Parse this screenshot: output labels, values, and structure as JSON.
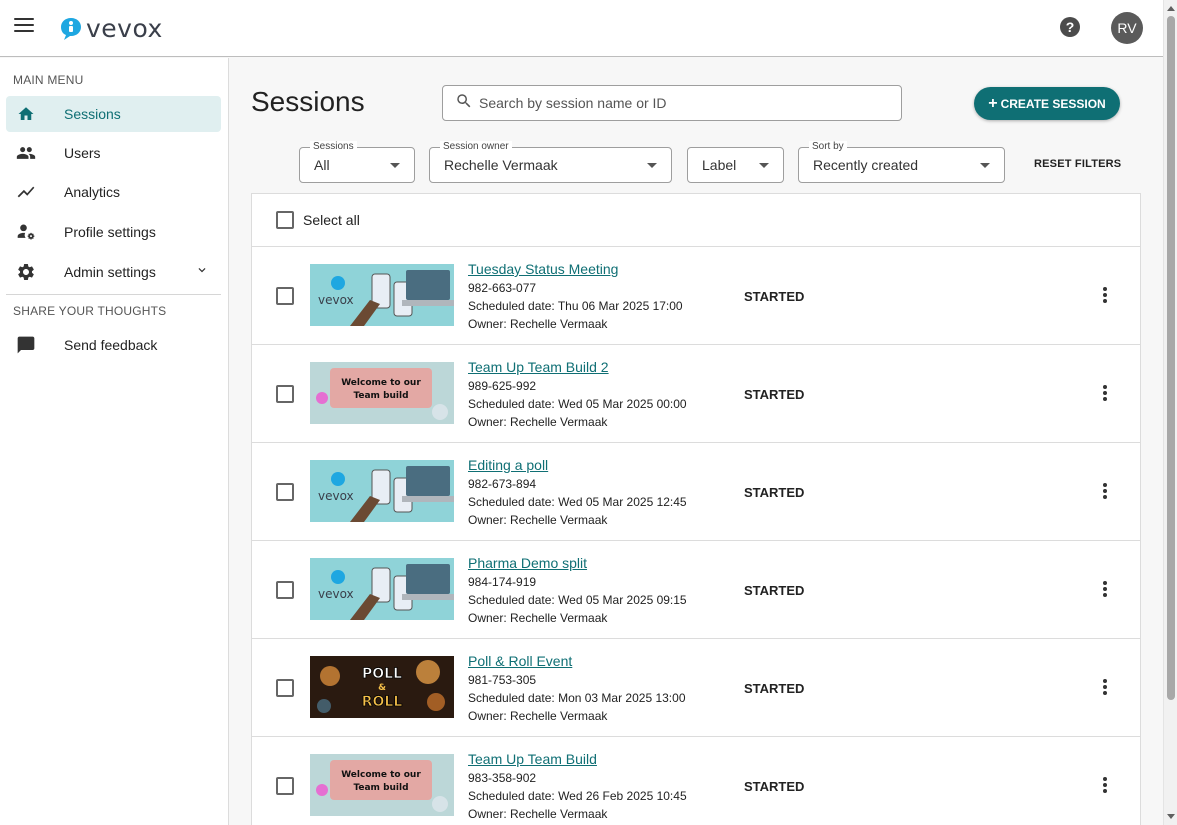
{
  "app": {
    "logo_text": "vevox"
  },
  "header": {
    "help_label": "?",
    "avatar_initials": "RV"
  },
  "sidebar": {
    "main_menu_heading": "MAIN MENU",
    "items": [
      {
        "label": "Sessions",
        "icon": "home-icon",
        "active": true
      },
      {
        "label": "Users",
        "icon": "users-icon"
      },
      {
        "label": "Analytics",
        "icon": "analytics-icon"
      },
      {
        "label": "Profile settings",
        "icon": "profile-settings-icon"
      },
      {
        "label": "Admin settings",
        "icon": "gear-icon"
      }
    ],
    "share_heading": "SHARE YOUR THOUGHTS",
    "feedback_label": "Send feedback"
  },
  "main": {
    "title": "Sessions",
    "search_placeholder": "Search by session name or ID",
    "create_button": "CREATE SESSION",
    "filters": {
      "sessions": {
        "label": "Sessions",
        "value": "All"
      },
      "owner": {
        "label": "Session owner",
        "value": "Rechelle Vermaak"
      },
      "label": {
        "value": "Label"
      },
      "sort": {
        "label": "Sort by",
        "value": "Recently created"
      }
    },
    "reset_filters": "RESET FILTERS",
    "select_all": "Select all",
    "sessions": [
      {
        "name": "Tuesday Status Meeting",
        "id": "982-663-077",
        "date": "Scheduled date: Thu 06 Mar 2025 17:00",
        "owner": "Owner: Rechelle Vermaak",
        "status": "STARTED",
        "thumb": "vevox"
      },
      {
        "name": "Team Up Team Build 2",
        "id": "989-625-992",
        "date": "Scheduled date: Wed 05 Mar 2025 00:00",
        "owner": "Owner: Rechelle Vermaak",
        "status": "STARTED",
        "thumb": "teambuild"
      },
      {
        "name": "Editing a poll",
        "id": "982-673-894",
        "date": "Scheduled date: Wed 05 Mar 2025 12:45",
        "owner": "Owner: Rechelle Vermaak",
        "status": "STARTED",
        "thumb": "vevox"
      },
      {
        "name": "Pharma Demo split",
        "id": "984-174-919",
        "date": "Scheduled date: Wed 05 Mar 2025 09:15",
        "owner": "Owner: Rechelle Vermaak",
        "status": "STARTED",
        "thumb": "vevox"
      },
      {
        "name": "Poll & Roll Event",
        "id": "981-753-305",
        "date": "Scheduled date: Mon 03 Mar 2025 13:00",
        "owner": "Owner: Rechelle Vermaak",
        "status": "STARTED",
        "thumb": "pollroll"
      },
      {
        "name": "Team Up Team Build",
        "id": "983-358-902",
        "date": "Scheduled date: Wed 26 Feb 2025 10:45",
        "owner": "Owner: Rechelle Vermaak",
        "status": "STARTED",
        "thumb": "teambuild"
      }
    ],
    "thumb_text": {
      "vevox": "vevox",
      "teambuild_line1": "Welcome to our",
      "teambuild_line2": "Team build",
      "pollroll_line1": "POLL",
      "pollroll_line2": "&",
      "pollroll_line3": "ROLL"
    }
  },
  "colors": {
    "accent": "#0f6f74",
    "active_bg": "#e0eff0"
  }
}
